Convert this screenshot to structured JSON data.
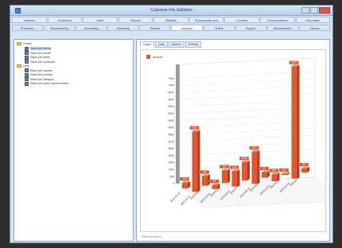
{
  "window": {
    "title": "Customer File Statistics"
  },
  "ribbon": {
    "row1": [
      "Incidents",
      "Customers",
      "Sales",
      "Reports",
      "Statistics",
      "Professionals area",
      "Contacts",
      "Communications",
      "Information"
    ],
    "row2": [
      "Production",
      "Manufacturing",
      "Accounting",
      "Marketing",
      "Website",
      "Analytics",
      "Charts",
      "Support",
      "Administration",
      "Options"
    ],
    "row2_active": 5
  },
  "tree": {
    "nodes": [
      {
        "label": "Charts",
        "type": "folder",
        "level": 0
      },
      {
        "label": "Sales per period",
        "type": "doc",
        "level": 1,
        "selected": true
      },
      {
        "label": "Sales per month",
        "type": "doc",
        "level": 1
      },
      {
        "label": "Sales per week",
        "type": "doc",
        "level": 1
      },
      {
        "label": "Sales per customer",
        "type": "doc",
        "level": 1
      },
      {
        "label": "Lists",
        "type": "folder",
        "level": 0
      },
      {
        "label": "Sales per country",
        "type": "doc",
        "level": 1
      },
      {
        "label": "Sales per product",
        "type": "doc",
        "level": 1
      },
      {
        "label": "Sales per category",
        "type": "doc",
        "level": 1
      },
      {
        "label": "Sales per sales representative",
        "type": "doc",
        "level": 1
      }
    ]
  },
  "subtabs": [
    "Graph",
    "Data",
    "Options",
    "Printing"
  ],
  "subtab_active": 0,
  "status": "Sales by period",
  "colors": {
    "bar": "#e2572f",
    "bar_side": "#b23d1d",
    "bar_top": "#f08a68"
  },
  "chart_data": {
    "type": "bar",
    "title": "",
    "series": [
      {
        "name": "Amount",
        "values": [
          400,
          4300,
          700,
          300,
          900,
          1100,
          1300,
          2300,
          400,
          500,
          100,
          8000,
          300
        ]
      }
    ],
    "categories": [
      "2013-01-01",
      "2013-02-01",
      "2013-03-01",
      "2013-04-01",
      "2013-05-01",
      "2013-06-01",
      "2013-07-01",
      "2013-08-01",
      "2013-09-01",
      "2013-10-01",
      "2013-11-01",
      "2013-12-01",
      "2014-01-01"
    ],
    "yticks": [
      "0",
      "500",
      "1000",
      "1500",
      "2000",
      "2500",
      "3000",
      "3500",
      "4000",
      "4500",
      "5000",
      "5500",
      "6000",
      "6500",
      "7000",
      "7500"
    ],
    "value_labels": [
      "400",
      "4300",
      "700",
      "300",
      "900",
      "1100",
      "1300",
      "2300",
      "400",
      "500",
      "100",
      "8000",
      "300"
    ],
    "ylim": [
      0,
      8500
    ],
    "grid": true,
    "legend": "top-left"
  }
}
